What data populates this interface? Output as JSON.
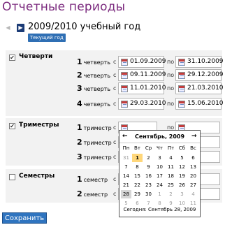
{
  "header": {
    "title": "Отчетные периоды"
  },
  "year_nav": {
    "prev_icon": "◀",
    "next_icon": "▶",
    "year_label": "2009/2010 учебный год",
    "current_button": "Текущий год"
  },
  "labels": {
    "from": "с",
    "to": "по"
  },
  "groups": [
    {
      "label": "Четверти",
      "checked": true,
      "check_glyph": "✔",
      "rows": [
        {
          "num": "1",
          "label": "четверть",
          "start": "01.09.2009",
          "end": "31.10.2009"
        },
        {
          "num": "2",
          "label": "четверть",
          "start": "09.11.2009",
          "end": "29.12.2009"
        },
        {
          "num": "3",
          "label": "четверть",
          "start": "11.01.2010",
          "end": "21.03.2010"
        },
        {
          "num": "4",
          "label": "четверть",
          "start": "29.03.2010",
          "end": "15.06.2010"
        }
      ]
    },
    {
      "label": "Триместры",
      "checked": true,
      "check_glyph": "✔",
      "rows": [
        {
          "num": "1",
          "label": "триместр",
          "start": "",
          "end": ""
        },
        {
          "num": "2",
          "label": "триместр",
          "start": "",
          "end": ""
        },
        {
          "num": "3",
          "label": "триместр",
          "start": "",
          "end": ""
        }
      ]
    },
    {
      "label": "Семестры",
      "checked": false,
      "check_glyph": "",
      "rows": [
        {
          "num": "1",
          "label": "семестр",
          "start": "",
          "end": ""
        },
        {
          "num": "2",
          "label": "семестр",
          "start": "",
          "end": ""
        }
      ]
    }
  ],
  "calendar": {
    "prev": "←",
    "next": "→",
    "month_title": "Сентябрь, 2009",
    "weekdays": [
      "Пн",
      "Вт",
      "Ср",
      "Чт",
      "Пт",
      "Сб",
      "Вс"
    ],
    "weeks": [
      [
        "31",
        "1",
        "2",
        "3",
        "4",
        "5",
        "6"
      ],
      [
        "7",
        "8",
        "9",
        "10",
        "11",
        "12",
        "13"
      ],
      [
        "14",
        "15",
        "16",
        "17",
        "18",
        "19",
        "20"
      ],
      [
        "21",
        "22",
        "23",
        "24",
        "25",
        "26",
        "27"
      ],
      [
        "28",
        "29",
        "30",
        "1",
        "2",
        "3",
        "4"
      ],
      [
        "5",
        "6",
        "7",
        "8",
        "9",
        "10",
        "11"
      ]
    ],
    "footer": "Сегодня: Сентябрь 28, 2009"
  },
  "footer": {
    "save_label": "Сохранить"
  },
  "colors": {
    "title": "#7b2a7e",
    "accent": "#2f74bf",
    "nav_active": "#1b3b76",
    "selected_day": "#ffd77a"
  }
}
